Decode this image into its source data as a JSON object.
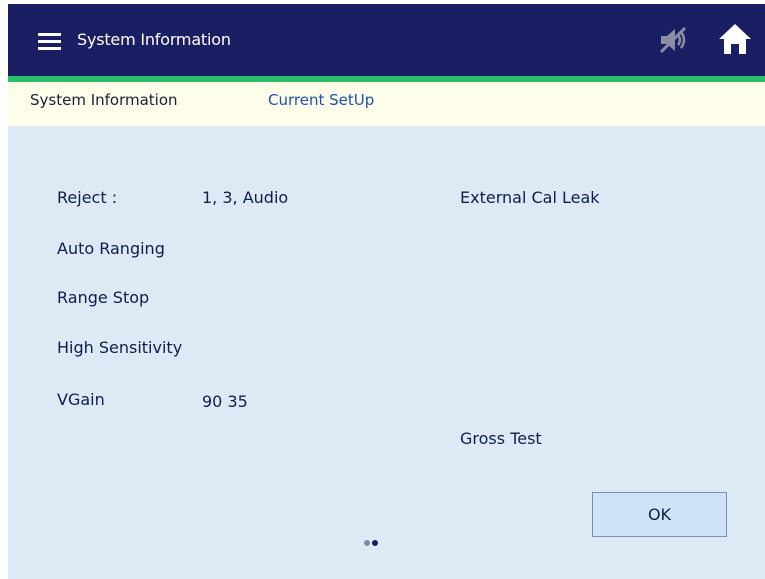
{
  "header": {
    "title": "System Information",
    "icons": {
      "menu": "hamburger-menu-icon",
      "mute": "speaker-muted-icon",
      "home": "home-icon"
    }
  },
  "tabs": [
    {
      "label": "System Information",
      "active": true
    },
    {
      "label": "Current SetUp",
      "active": false
    }
  ],
  "info": {
    "reject_label": "Reject :",
    "reject_value": "1, 3, Audio",
    "auto_ranging": "Auto Ranging",
    "range_stop": "Range Stop",
    "high_sensitivity": "High Sensitivity",
    "vgain_label": "VGain",
    "vgain_value": "90 35",
    "external_cal_leak": "External Cal Leak",
    "gross_test": "Gross Test"
  },
  "actions": {
    "ok_label": "OK"
  },
  "pager": {
    "pages": 2,
    "current": 2
  },
  "colors": {
    "header_bg": "#1a1f63",
    "accent": "#2bbf6a",
    "tabbar_bg": "#fdfde9",
    "content_bg": "#dde9f4",
    "link": "#1f4fb0"
  }
}
